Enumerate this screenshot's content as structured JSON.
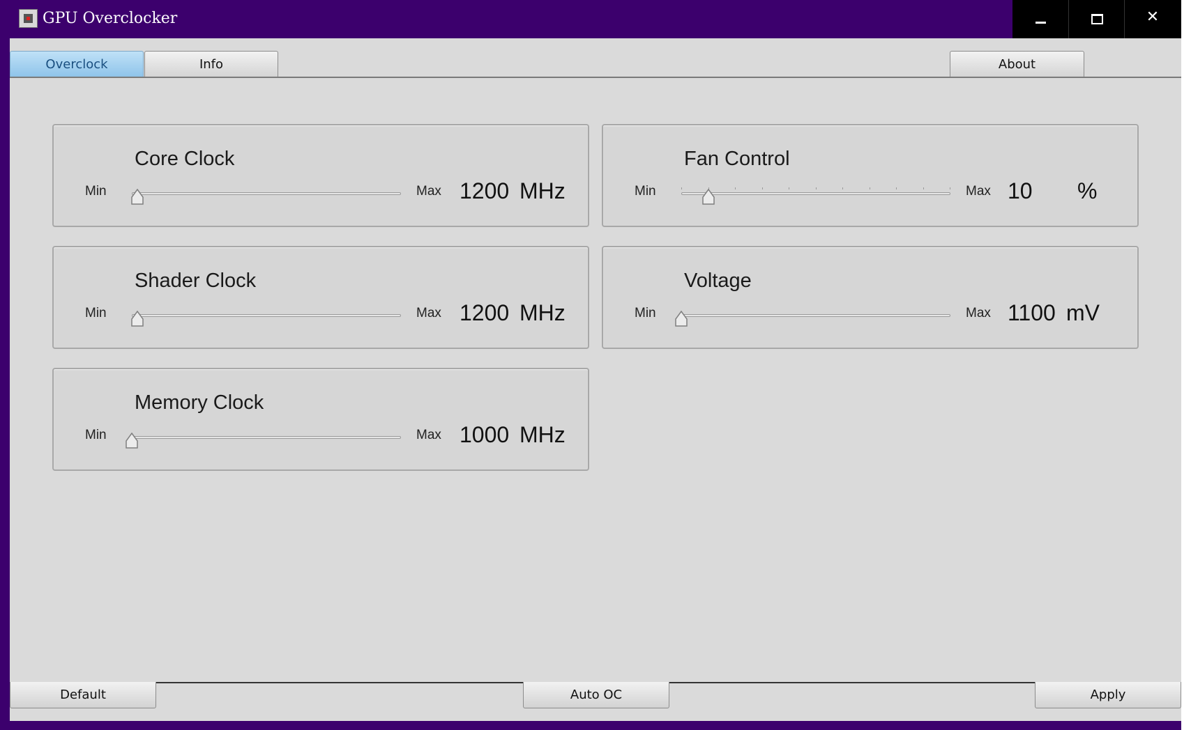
{
  "window": {
    "title": "GPU Overclocker"
  },
  "tabs": [
    {
      "label": "Overclock",
      "active": true
    },
    {
      "label": "Info",
      "active": false
    }
  ],
  "about_label": "About",
  "panels": [
    {
      "id": "core-clock",
      "title": "Core Clock",
      "min_label": "Min",
      "max_label": "Max",
      "value": "1200",
      "unit": "MHz",
      "slider_position": 0.02
    },
    {
      "id": "fan-control",
      "title": "Fan Control",
      "min_label": "Min",
      "max_label": "Max",
      "value": "10",
      "unit": "%",
      "slider_position": 0.1
    },
    {
      "id": "shader-clock",
      "title": "Shader Clock",
      "min_label": "Min",
      "max_label": "Max",
      "value": "1200",
      "unit": "MHz",
      "slider_position": 0.02
    },
    {
      "id": "voltage",
      "title": "Voltage",
      "min_label": "Min",
      "max_label": "Max",
      "value": "1100",
      "unit": "mV",
      "slider_position": 0.0
    },
    {
      "id": "memory-clock",
      "title": "Memory Clock",
      "min_label": "Min",
      "max_label": "Max",
      "value": "1000",
      "unit": "MHz",
      "slider_position": 0.0
    }
  ],
  "buttons": {
    "default": "Default",
    "auto_oc": "Auto OC",
    "apply": "Apply"
  },
  "colors": {
    "titlebar": "#3c006d",
    "active_tab": "#9fcdee",
    "client_bg": "#dadada"
  }
}
